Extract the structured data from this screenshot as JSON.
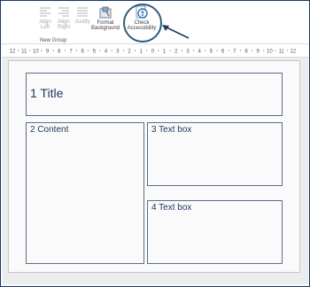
{
  "ribbon": {
    "buttons": [
      {
        "label1": "Align",
        "label2": "Left"
      },
      {
        "label1": "Align",
        "label2": "Right"
      },
      {
        "label1": "Justify",
        "label2": ""
      },
      {
        "label1": "Format",
        "label2": "Background"
      },
      {
        "label1": "Check",
        "label2": "Accessibility"
      }
    ],
    "group_label": "New Group"
  },
  "ruler": {
    "labels": [
      "12",
      "11",
      "10",
      "9",
      "8",
      "7",
      "6",
      "5",
      "4",
      "3",
      "2",
      "1",
      "0",
      "1",
      "2",
      "3",
      "4",
      "5",
      "6",
      "7",
      "8",
      "9",
      "10",
      "11",
      "12"
    ]
  },
  "slide": {
    "title": "1 Title",
    "content": "2 Content",
    "textbox3": "3 Text box",
    "textbox4": "4 Text box"
  },
  "colors": {
    "accent": "#2f5b7c",
    "placeholder_text": "#1f3864",
    "placeholder_border": "#5a6e8c"
  }
}
